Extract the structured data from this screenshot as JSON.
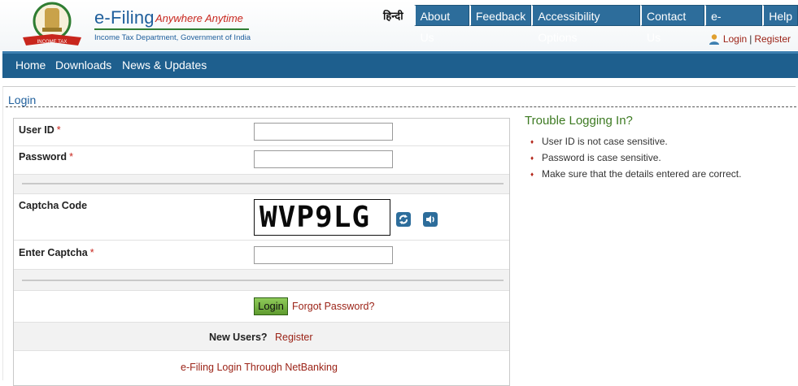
{
  "header": {
    "brand_title": "e-Filing",
    "brand_tagline": "Anywhere Anytime",
    "brand_sub": "Income Tax Department, Government of India",
    "hindi_link": "हिन्दी",
    "nav": [
      "About Us",
      "Feedback",
      "Accessibility Options",
      "Contact Us",
      "e-Nivaran",
      "Help"
    ],
    "login_link": "Login",
    "separator": "|",
    "register_link": "Register"
  },
  "menu": {
    "home": "Home",
    "downloads": "Downloads",
    "news": "News & Updates"
  },
  "section_title": "Login",
  "form": {
    "user_id_label": "User ID",
    "password_label": "Password",
    "captcha_label": "Captcha Code",
    "captcha_text": "WVP9LG",
    "enter_captcha_label": "Enter Captcha",
    "required_mark": "*",
    "login_button": "Login",
    "forgot_password": "Forgot Password?",
    "new_users_label": "New Users?",
    "register_link": "Register",
    "netbanking_link": "e-Filing Login Through NetBanking"
  },
  "trouble": {
    "title": "Trouble Logging In?",
    "items": [
      "User ID is not case sensitive.",
      "Password is case sensitive.",
      "Make sure that the details entered are correct."
    ]
  },
  "icons": {
    "emblem": "state-emblem-icon",
    "user": "user-icon",
    "refresh": "refresh-icon",
    "audio": "speaker-icon"
  },
  "colors": {
    "brand_blue": "#1f5f9c",
    "nav_blue": "#2d6d9b",
    "menubar": "#1e5f8e",
    "link_red": "#9b2317",
    "trouble_green": "#3d7a22"
  }
}
